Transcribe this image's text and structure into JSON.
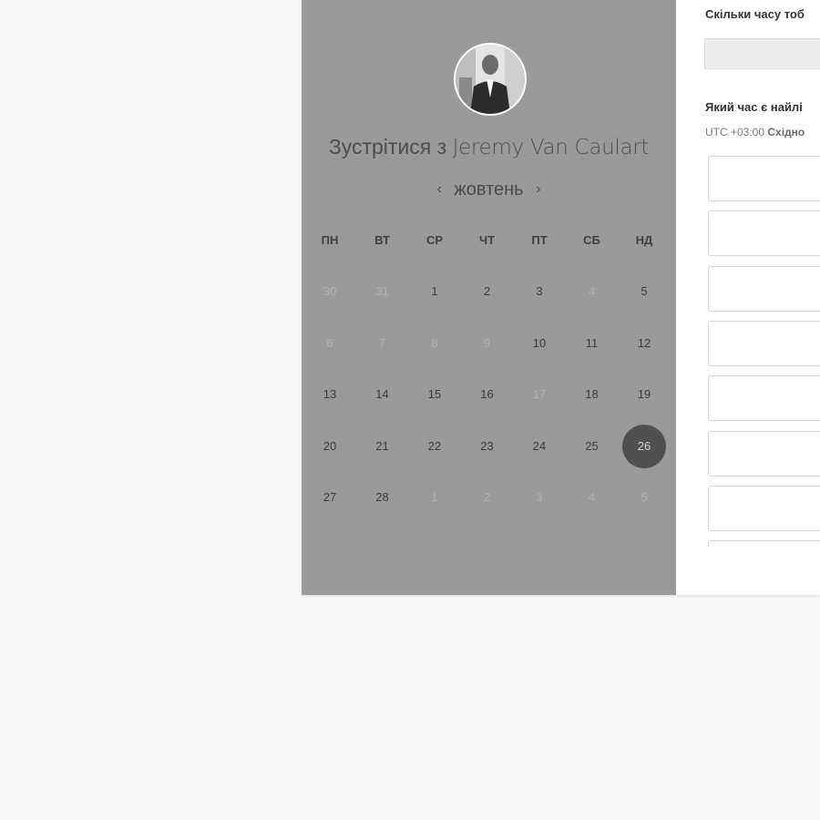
{
  "host": {
    "prefix": "Зустрітися з ",
    "name": "Jeremy Van Caulart"
  },
  "calendar": {
    "month": "жовтень",
    "prev_arrow": "‹",
    "next_arrow": "›",
    "weekdays": [
      "ПН",
      "ВТ",
      "СР",
      "ЧТ",
      "ПТ",
      "СБ",
      "НД"
    ],
    "weeks": [
      [
        {
          "d": "30",
          "muted": true
        },
        {
          "d": "31",
          "muted": true
        },
        {
          "d": "1"
        },
        {
          "d": "2"
        },
        {
          "d": "3"
        },
        {
          "d": "4",
          "muted": true
        },
        {
          "d": "5"
        }
      ],
      [
        {
          "d": "6",
          "muted": true
        },
        {
          "d": "7",
          "muted": true
        },
        {
          "d": "8",
          "muted": true
        },
        {
          "d": "9",
          "muted": true
        },
        {
          "d": "10"
        },
        {
          "d": "11"
        },
        {
          "d": "12"
        }
      ],
      [
        {
          "d": "13"
        },
        {
          "d": "14"
        },
        {
          "d": "15"
        },
        {
          "d": "16"
        },
        {
          "d": "17",
          "muted": true
        },
        {
          "d": "18"
        },
        {
          "d": "19"
        }
      ],
      [
        {
          "d": "20"
        },
        {
          "d": "21"
        },
        {
          "d": "22"
        },
        {
          "d": "23"
        },
        {
          "d": "24"
        },
        {
          "d": "25"
        },
        {
          "d": "26",
          "selected": true
        }
      ],
      [
        {
          "d": "27"
        },
        {
          "d": "28"
        },
        {
          "d": "1",
          "muted": true
        },
        {
          "d": "2",
          "muted": true
        },
        {
          "d": "3",
          "muted": true
        },
        {
          "d": "4",
          "muted": true
        },
        {
          "d": "5",
          "muted": true
        }
      ]
    ]
  },
  "booking": {
    "duration_question": "Скільки часу тоб",
    "time_question": "Який час є найлі",
    "timezone_offset": "UTC +03:00",
    "timezone_name": "Східно",
    "slot_count": 8
  },
  "colors": {
    "overlay": "#9a9a9a",
    "selected_day": "#505050",
    "background": "#f7f7f7"
  }
}
